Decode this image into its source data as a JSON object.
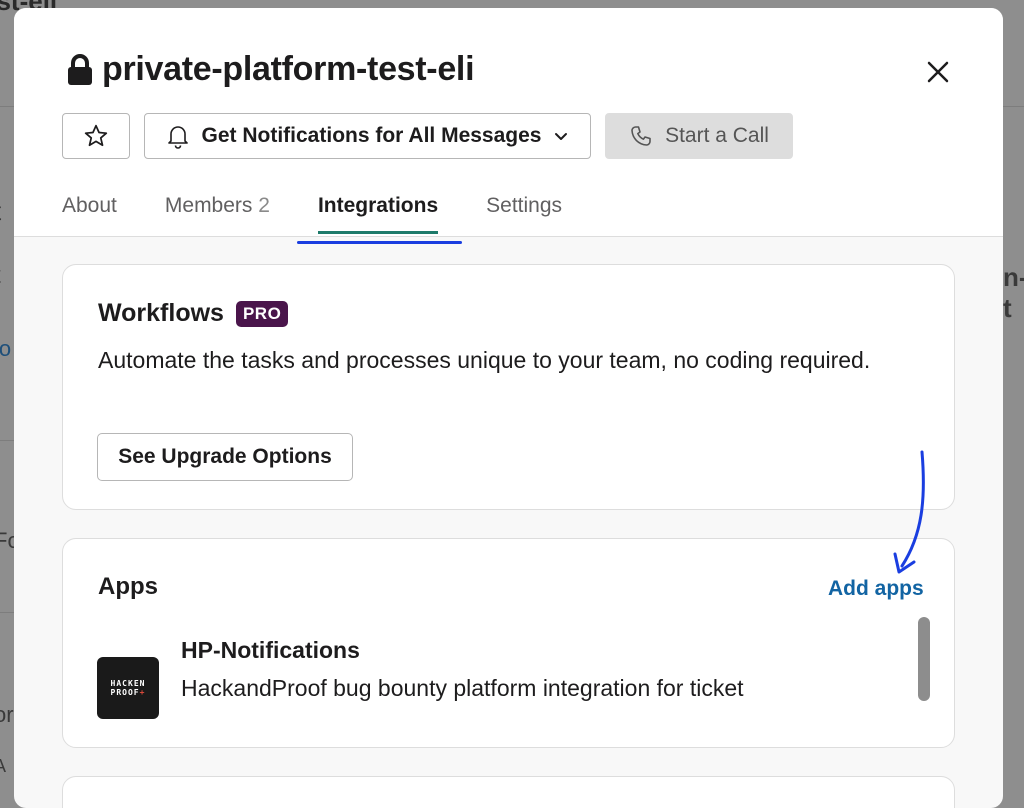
{
  "background": {
    "title_fragment": "est-eli",
    "fragments": [
      "t",
      "t",
      "lo",
      "Fo",
      "or",
      "A",
      "n-t"
    ]
  },
  "modal": {
    "title": "private-platform-test-eli",
    "buttons": {
      "notifications_label": "Get Notifications for All Messages",
      "call_label": "Start a Call"
    },
    "tabs": [
      {
        "label": "About",
        "count": ""
      },
      {
        "label": "Members",
        "count": "2"
      },
      {
        "label": "Integrations",
        "count": ""
      },
      {
        "label": "Settings",
        "count": ""
      }
    ],
    "active_tab": "Integrations",
    "workflows": {
      "title": "Workflows",
      "badge": "PRO",
      "description": "Automate the tasks and processes unique to your team, no coding required.",
      "upgrade_label": "See Upgrade Options"
    },
    "apps": {
      "title": "Apps",
      "add_label": "Add apps",
      "items": [
        {
          "name": "HP-Notifications",
          "description": "HackandProof bug bounty platform integration for ticket",
          "logo_text": [
            "HACKEN",
            "PROOF"
          ]
        }
      ]
    }
  },
  "colors": {
    "accent_tab": "#1d7a6a",
    "link": "#1264a3",
    "pro_badge": "#4a154b",
    "annotation": "#1a3ee0"
  },
  "icons": [
    "lock-icon",
    "close-icon",
    "star-icon",
    "bell-icon",
    "chevron-down-icon",
    "phone-icon"
  ]
}
